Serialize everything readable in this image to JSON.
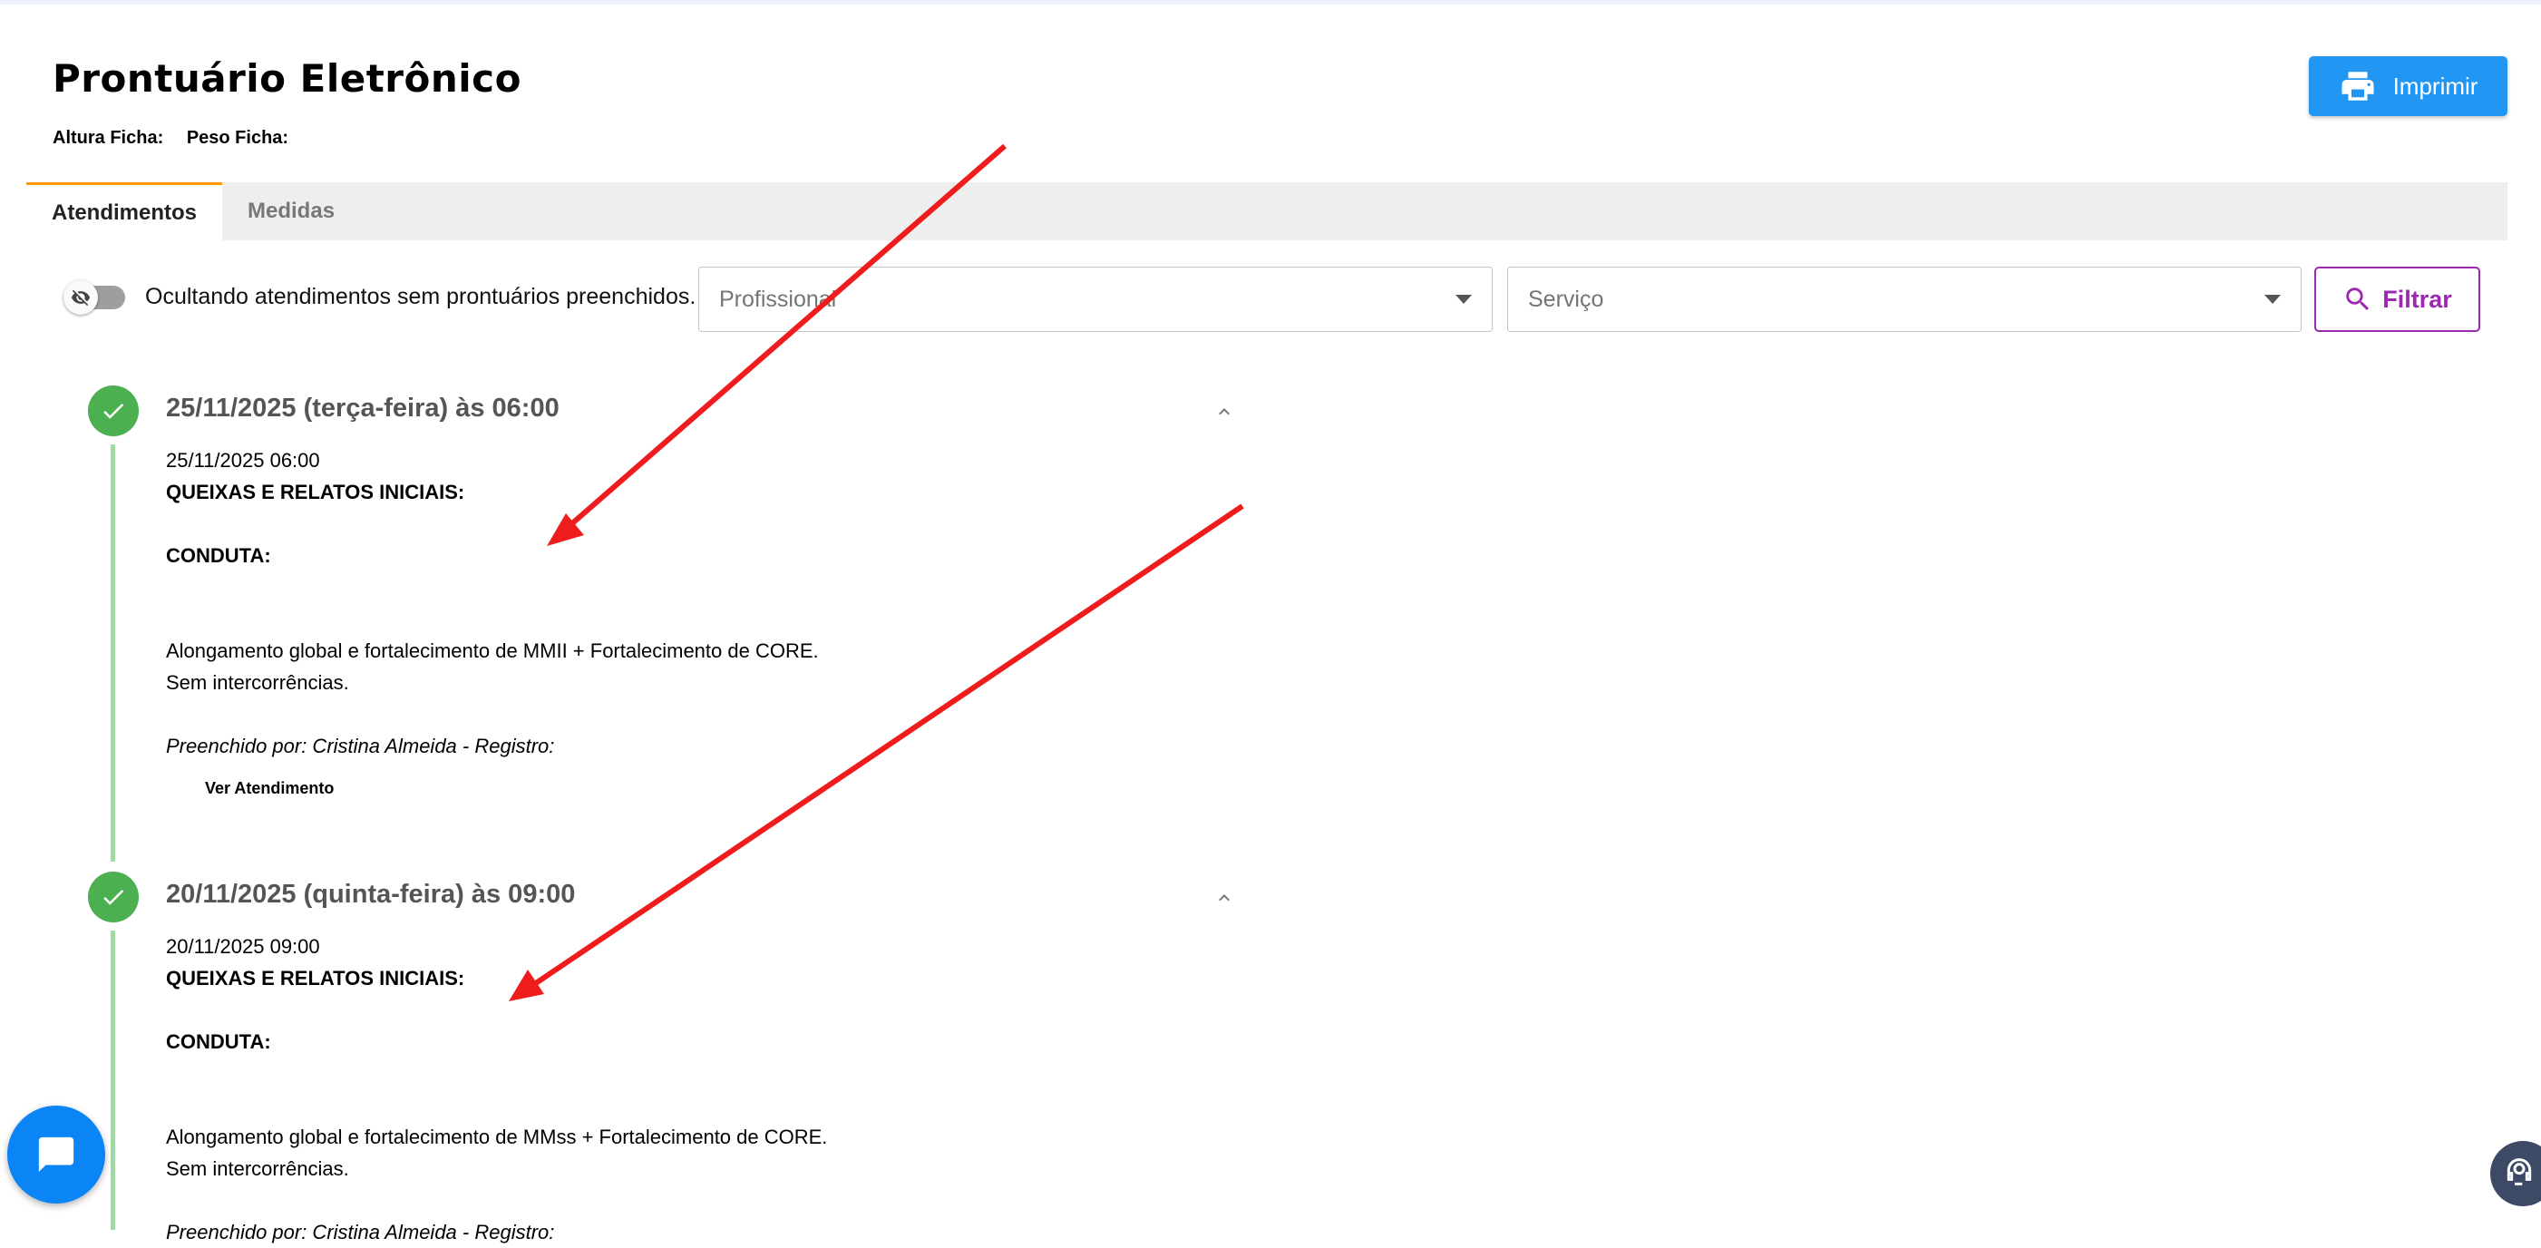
{
  "header": {
    "title": "Prontuário Eletrônico",
    "altura_label": "Altura Ficha:",
    "peso_label": "Peso Ficha:",
    "print_label": "Imprimir"
  },
  "tabs": [
    {
      "label": "Atendimentos",
      "active": true
    },
    {
      "label": "Medidas",
      "active": false
    }
  ],
  "filters": {
    "toggle_label": "Ocultando atendimentos sem prontuários preenchidos.",
    "toggle_on": false,
    "profissional_placeholder": "Profissional",
    "servico_placeholder": "Serviço",
    "filter_label": "Filtrar"
  },
  "entries": [
    {
      "heading": "25/11/2025 (terça-feira) às 06:00",
      "datetime": "25/11/2025 06:00",
      "queixas_label": "QUEIXAS E RELATOS INICIAIS:",
      "conduta_label": "CONDUTA:",
      "text_line1": "Alongamento global e fortalecimento de MMII + Fortalecimento de CORE.",
      "text_line2": "Sem intercorrências.",
      "filled_by": "Preenchido por: Cristina Almeida - Registro:",
      "link_label": "Ver Atendimento"
    },
    {
      "heading": "20/11/2025 (quinta-feira) às 09:00",
      "datetime": "20/11/2025 09:00",
      "queixas_label": "QUEIXAS E RELATOS INICIAIS:",
      "conduta_label": "CONDUTA:",
      "text_line1": "Alongamento global e fortalecimento de MMss + Fortalecimento de CORE.",
      "text_line2": "Sem intercorrências.",
      "filled_by": "Preenchido por: Cristina Almeida - Registro:"
    }
  ],
  "colors": {
    "print_button": "#2196f3",
    "filter_accent": "#9c27b0",
    "tab_indicator": "#ff9800",
    "timeline_dot": "#4caf50",
    "timeline_line": "#a5d6a7",
    "chat_fab": "#0b84f5",
    "annotation_arrow": "#ee1c1c"
  },
  "icons": [
    "printer-icon",
    "eye-off-icon",
    "search-icon",
    "check-icon",
    "chevron-up-icon",
    "chat-icon",
    "support-agent-icon"
  ]
}
